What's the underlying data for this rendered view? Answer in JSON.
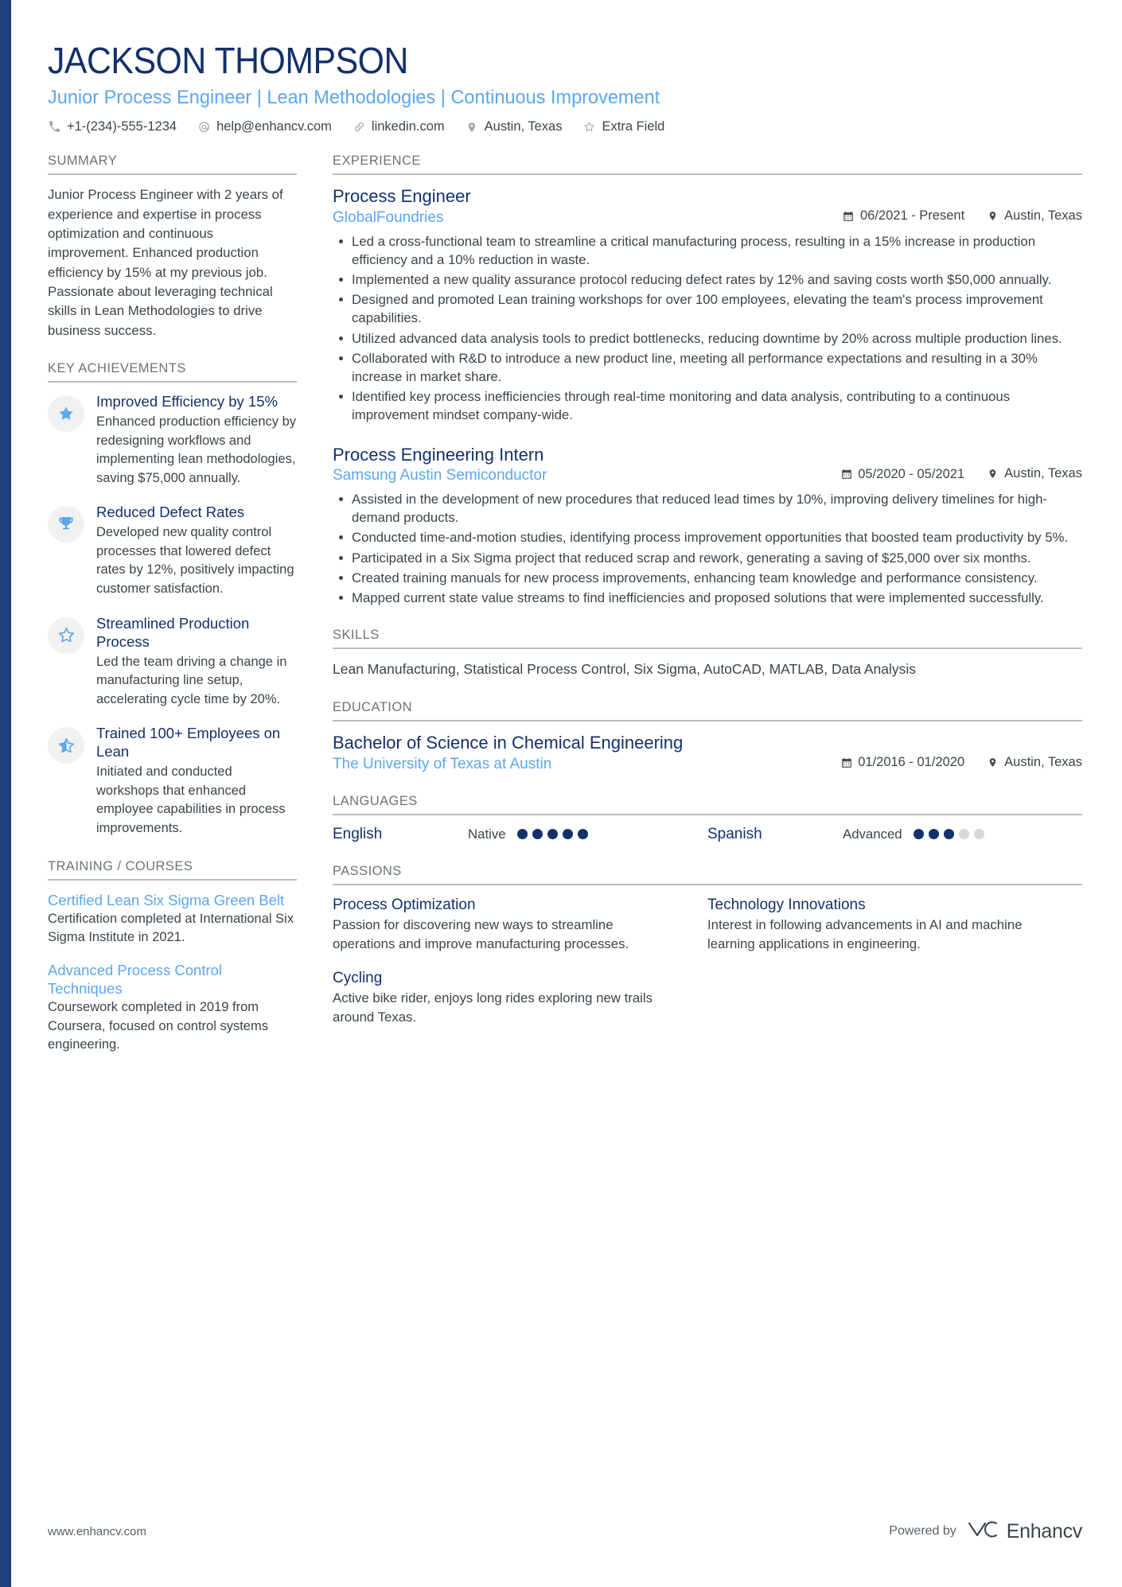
{
  "header": {
    "name": "JACKSON THOMPSON",
    "headline": "Junior Process Engineer | Lean Methodologies | Continuous Improvement",
    "contacts": [
      {
        "icon": "phone-icon",
        "text": "+1-(234)-555-1234"
      },
      {
        "icon": "email-icon",
        "text": "help@enhancv.com"
      },
      {
        "icon": "link-icon",
        "text": "linkedin.com"
      },
      {
        "icon": "location-pin-icon",
        "text": "Austin, Texas"
      },
      {
        "icon": "star-outline-icon",
        "text": "Extra Field"
      }
    ]
  },
  "sidebar": {
    "summary": {
      "title": "SUMMARY",
      "text": "Junior Process Engineer with 2 years of experience and expertise in process optimization and continuous improvement. Enhanced production efficiency by 15% at my previous job. Passionate about leveraging technical skills in Lean Methodologies to drive business success."
    },
    "key_achievements": {
      "title": "KEY ACHIEVEMENTS",
      "items": [
        {
          "icon": "star-filled-icon",
          "title": "Improved Efficiency by 15%",
          "description": "Enhanced production efficiency by redesigning workflows and implementing lean methodologies, saving $75,000 annually."
        },
        {
          "icon": "trophy-icon",
          "title": "Reduced Defect Rates",
          "description": "Developed new quality control processes that lowered defect rates by 12%, positively impacting customer satisfaction."
        },
        {
          "icon": "star-outline-icon",
          "title": "Streamlined Production Process",
          "description": "Led the team driving a change in manufacturing line setup, accelerating cycle time by 20%."
        },
        {
          "icon": "star-half-icon",
          "title": "Trained 100+ Employees on Lean",
          "description": "Initiated and conducted workshops that enhanced employee capabilities in process improvements."
        }
      ]
    },
    "training": {
      "title": "TRAINING / COURSES",
      "items": [
        {
          "title": "Certified Lean Six Sigma Green Belt",
          "description": "Certification completed at International Six Sigma Institute in 2021."
        },
        {
          "title": "Advanced Process Control Techniques",
          "description": "Coursework completed in 2019 from Coursera, focused on control systems engineering."
        }
      ]
    }
  },
  "main": {
    "experience": {
      "title": "EXPERIENCE",
      "jobs": [
        {
          "role": "Process Engineer",
          "company": "GlobalFoundries",
          "dates": "06/2021 - Present",
          "location": "Austin, Texas",
          "bullets": [
            "Led a cross-functional team to streamline a critical manufacturing process, resulting in a 15% increase in production efficiency and a 10% reduction in waste.",
            "Implemented a new quality assurance protocol reducing defect rates by 12% and saving costs worth $50,000 annually.",
            "Designed and promoted Lean training workshops for over 100 employees, elevating the team's process improvement capabilities.",
            "Utilized advanced data analysis tools to predict bottlenecks, reducing downtime by 20% across multiple production lines.",
            "Collaborated with R&D to introduce a new product line, meeting all performance expectations and resulting in a 30% increase in market share.",
            "Identified key process inefficiencies through real-time monitoring and data analysis, contributing to a continuous improvement mindset company-wide."
          ]
        },
        {
          "role": "Process Engineering Intern",
          "company": "Samsung Austin Semiconductor",
          "dates": "05/2020 - 05/2021",
          "location": "Austin, Texas",
          "bullets": [
            "Assisted in the development of new procedures that reduced lead times by 10%, improving delivery timelines for high-demand products.",
            "Conducted time-and-motion studies, identifying process improvement opportunities that boosted team productivity by 5%.",
            "Participated in a Six Sigma project that reduced scrap and rework, generating a saving of $25,000 over six months.",
            "Created training manuals for new process improvements, enhancing team knowledge and performance consistency.",
            "Mapped current state value streams to find inefficiencies and proposed solutions that were implemented successfully."
          ]
        }
      ]
    },
    "skills": {
      "title": "SKILLS",
      "text": "Lean Manufacturing, Statistical Process Control, Six Sigma, AutoCAD, MATLAB, Data Analysis"
    },
    "education": {
      "title": "EDUCATION",
      "degree": "Bachelor of Science in Chemical Engineering",
      "school": "The University of Texas at Austin",
      "dates": "01/2016 - 01/2020",
      "location": "Austin, Texas"
    },
    "languages": {
      "title": "LANGUAGES",
      "items": [
        {
          "name": "English",
          "level": "Native",
          "filled": 5,
          "total": 5
        },
        {
          "name": "Spanish",
          "level": "Advanced",
          "filled": 3,
          "total": 5
        }
      ]
    },
    "passions": {
      "title": "PASSIONS",
      "items": [
        {
          "title": "Process Optimization",
          "description": "Passion for discovering new ways to streamline operations and improve manufacturing processes."
        },
        {
          "title": "Technology Innovations",
          "description": "Interest in following advancements in AI and machine learning applications in engineering."
        },
        {
          "title": "Cycling",
          "description": "Active bike rider, enjoys long rides exploring new trails around Texas."
        }
      ]
    }
  },
  "footer": {
    "url": "www.enhancv.com",
    "powered_by": "Powered by",
    "brand": "Enhancv"
  },
  "colors": {
    "navy": "#13306b",
    "light_blue": "#5ba7ee",
    "body_gray": "#3b444d",
    "rule_gray": "#b9bec4",
    "accent_bar": "#1f3f7a"
  }
}
